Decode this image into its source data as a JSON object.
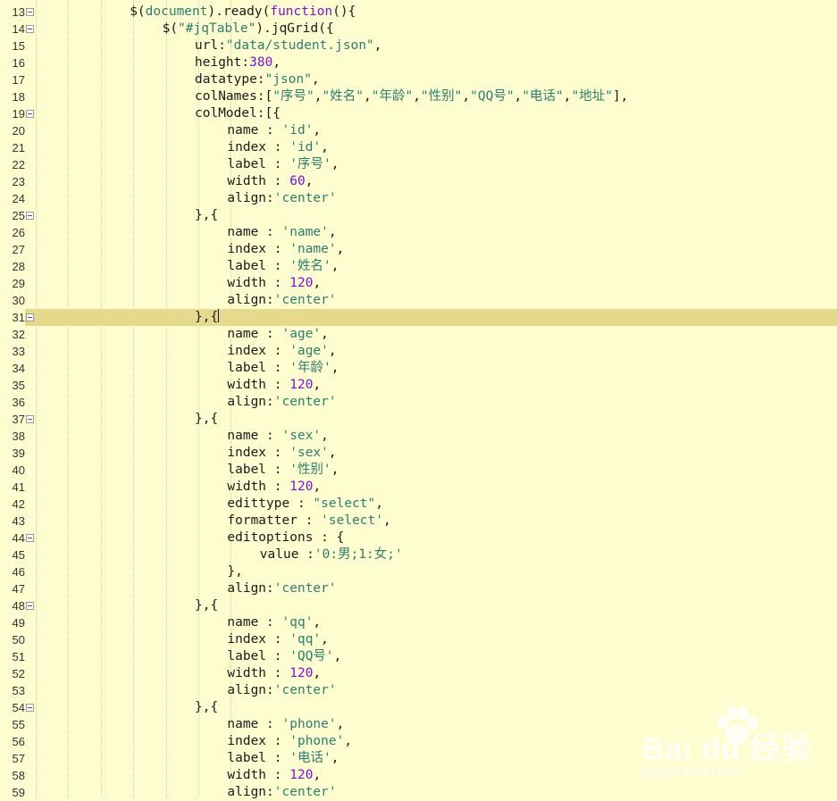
{
  "editor": {
    "lines": [
      {
        "n": "13",
        "fold": true,
        "indent": 3,
        "text": "$(document).ready(function(){"
      },
      {
        "n": "14",
        "fold": true,
        "indent": 4,
        "text": "$(\"#jqTable\").jqGrid({"
      },
      {
        "n": "15",
        "fold": false,
        "indent": 5,
        "text": "url:\"data/student.json\","
      },
      {
        "n": "16",
        "fold": false,
        "indent": 5,
        "text": "height:380,"
      },
      {
        "n": "17",
        "fold": false,
        "indent": 5,
        "text": "datatype:\"json\","
      },
      {
        "n": "18",
        "fold": false,
        "indent": 5,
        "text": "colNames:[\"序号\",\"姓名\",\"年龄\",\"性别\",\"QQ号\",\"电话\",\"地址\"],"
      },
      {
        "n": "19",
        "fold": true,
        "indent": 5,
        "text": "colModel:[{"
      },
      {
        "n": "20",
        "fold": false,
        "indent": 6,
        "text": "name : 'id',"
      },
      {
        "n": "21",
        "fold": false,
        "indent": 6,
        "text": "index : 'id',"
      },
      {
        "n": "22",
        "fold": false,
        "indent": 6,
        "text": "label : '序号',"
      },
      {
        "n": "23",
        "fold": false,
        "indent": 6,
        "text": "width : 60,"
      },
      {
        "n": "24",
        "fold": false,
        "indent": 6,
        "text": "align:'center'"
      },
      {
        "n": "25",
        "fold": true,
        "indent": 5,
        "text": "},{"
      },
      {
        "n": "26",
        "fold": false,
        "indent": 6,
        "text": "name : 'name',"
      },
      {
        "n": "27",
        "fold": false,
        "indent": 6,
        "text": "index : 'name',"
      },
      {
        "n": "28",
        "fold": false,
        "indent": 6,
        "text": "label : '姓名',"
      },
      {
        "n": "29",
        "fold": false,
        "indent": 6,
        "text": "width : 120,"
      },
      {
        "n": "30",
        "fold": false,
        "indent": 6,
        "text": "align:'center'"
      },
      {
        "n": "31",
        "fold": true,
        "indent": 5,
        "text": "},{",
        "current": true
      },
      {
        "n": "32",
        "fold": false,
        "indent": 6,
        "text": "name : 'age',"
      },
      {
        "n": "33",
        "fold": false,
        "indent": 6,
        "text": "index : 'age',"
      },
      {
        "n": "34",
        "fold": false,
        "indent": 6,
        "text": "label : '年龄',"
      },
      {
        "n": "35",
        "fold": false,
        "indent": 6,
        "text": "width : 120,"
      },
      {
        "n": "36",
        "fold": false,
        "indent": 6,
        "text": "align:'center'"
      },
      {
        "n": "37",
        "fold": true,
        "indent": 5,
        "text": "},{"
      },
      {
        "n": "38",
        "fold": false,
        "indent": 6,
        "text": "name : 'sex',"
      },
      {
        "n": "39",
        "fold": false,
        "indent": 6,
        "text": "index : 'sex',"
      },
      {
        "n": "40",
        "fold": false,
        "indent": 6,
        "text": "label : '性别',"
      },
      {
        "n": "41",
        "fold": false,
        "indent": 6,
        "text": "width : 120,"
      },
      {
        "n": "42",
        "fold": false,
        "indent": 6,
        "text": "edittype : \"select\","
      },
      {
        "n": "43",
        "fold": false,
        "indent": 6,
        "text": "formatter : 'select',"
      },
      {
        "n": "44",
        "fold": true,
        "indent": 6,
        "text": "editoptions : {"
      },
      {
        "n": "45",
        "fold": false,
        "indent": 7,
        "text": "value :'0:男;1:女;'"
      },
      {
        "n": "46",
        "fold": false,
        "indent": 6,
        "text": "},"
      },
      {
        "n": "47",
        "fold": false,
        "indent": 6,
        "text": "align:'center'"
      },
      {
        "n": "48",
        "fold": true,
        "indent": 5,
        "text": "},{"
      },
      {
        "n": "49",
        "fold": false,
        "indent": 6,
        "text": "name : 'qq',"
      },
      {
        "n": "50",
        "fold": false,
        "indent": 6,
        "text": "index : 'qq',"
      },
      {
        "n": "51",
        "fold": false,
        "indent": 6,
        "text": "label : 'QQ号',"
      },
      {
        "n": "52",
        "fold": false,
        "indent": 6,
        "text": "width : 120,"
      },
      {
        "n": "53",
        "fold": false,
        "indent": 6,
        "text": "align:'center'"
      },
      {
        "n": "54",
        "fold": true,
        "indent": 5,
        "text": "},{"
      },
      {
        "n": "55",
        "fold": false,
        "indent": 6,
        "text": "name : 'phone',"
      },
      {
        "n": "56",
        "fold": false,
        "indent": 6,
        "text": "index : 'phone',"
      },
      {
        "n": "57",
        "fold": false,
        "indent": 6,
        "text": "label : '电话',"
      },
      {
        "n": "58",
        "fold": false,
        "indent": 6,
        "text": "width : 120,"
      },
      {
        "n": "59",
        "fold": false,
        "indent": 6,
        "text": "align:'center'"
      }
    ]
  },
  "watermark": {
    "brand": "Bai du 经验",
    "url": "jingyan.baidu.com"
  },
  "colors": {
    "background": "#fdfdd0",
    "current_line": "#e5da8c",
    "number": "#7f0fd9",
    "string": "#2a7f6f"
  }
}
